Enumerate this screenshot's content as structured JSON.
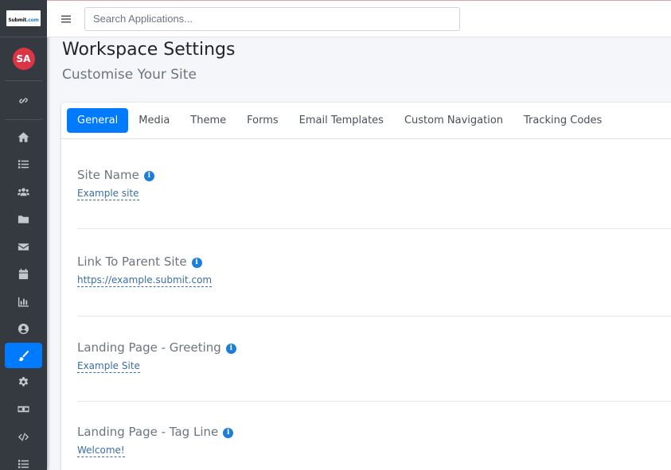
{
  "brand": {
    "logo_text": "Submit",
    "logo_suffix": ".com"
  },
  "user": {
    "initials": "SA"
  },
  "search": {
    "placeholder": "Search Applications..."
  },
  "page": {
    "title": "Workspace Settings",
    "subtitle": "Customise Your Site"
  },
  "sidebar": {
    "items": [
      {
        "icon": "link-icon"
      },
      {
        "icon": "home-icon"
      },
      {
        "icon": "list-icon"
      },
      {
        "icon": "users-icon"
      },
      {
        "icon": "folder-icon"
      },
      {
        "icon": "envelope-icon"
      },
      {
        "icon": "calendar-icon"
      },
      {
        "icon": "chart-icon"
      },
      {
        "icon": "user-circle-icon"
      },
      {
        "icon": "paint-brush-icon",
        "active": true
      },
      {
        "icon": "gear-icon"
      },
      {
        "icon": "money-icon"
      },
      {
        "icon": "code-icon"
      },
      {
        "icon": "list-icon"
      }
    ]
  },
  "tabs": [
    {
      "label": "General",
      "active": true
    },
    {
      "label": "Media"
    },
    {
      "label": "Theme"
    },
    {
      "label": "Forms"
    },
    {
      "label": "Email Templates"
    },
    {
      "label": "Custom Navigation"
    },
    {
      "label": "Tracking Codes"
    }
  ],
  "fields": [
    {
      "label": "Site Name",
      "value": "Example site"
    },
    {
      "label": "Link To Parent Site",
      "value": "https://example.submit.com"
    },
    {
      "label": "Landing Page - Greeting",
      "value": "Example Site"
    },
    {
      "label": "Landing Page - Tag Line",
      "value": "Welcome!"
    }
  ],
  "colors": {
    "accent": "#007bff",
    "sidebar_bg": "#343a40",
    "avatar_bg": "#dc3545",
    "link": "#3a6ea5"
  }
}
